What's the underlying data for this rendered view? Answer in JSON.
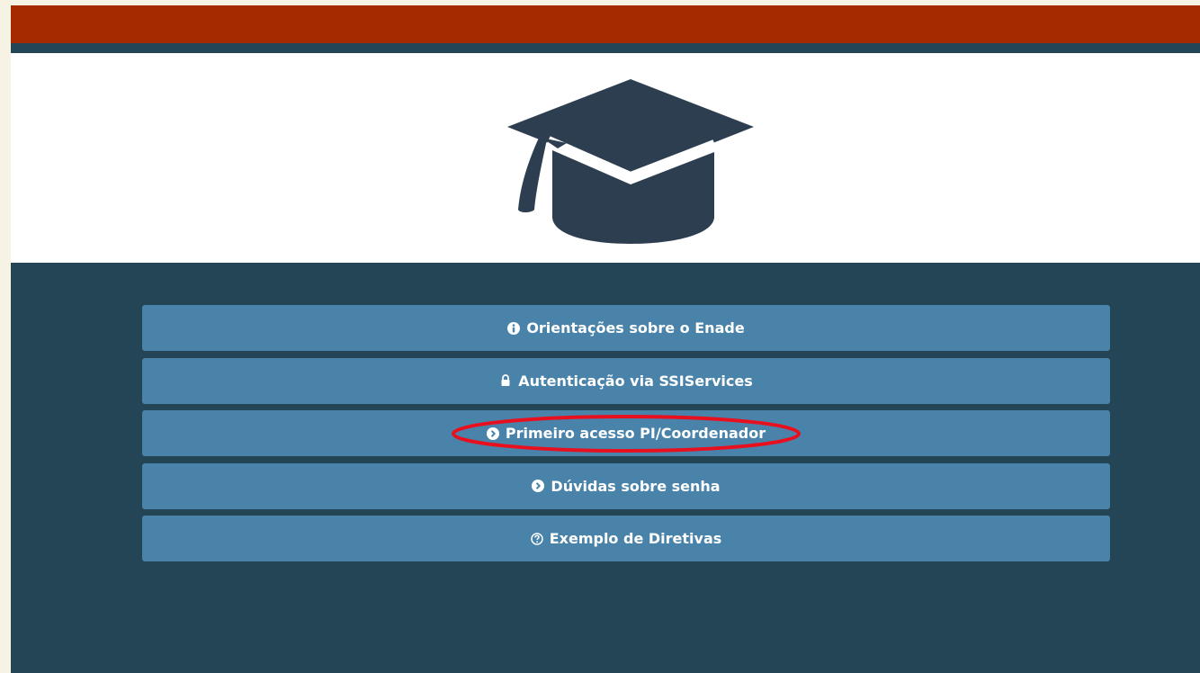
{
  "colors": {
    "page_background": "#f6f3e4",
    "top_bar": "#a52a00",
    "dark_navy": "#234556",
    "button_blue": "#4a83aa",
    "button_text": "#ffffff",
    "annotation_red": "#e8101e",
    "cap_color": "#2c3e50"
  },
  "logo": {
    "icon": "graduation-cap-icon"
  },
  "menu": {
    "items": [
      {
        "label": "Orientações sobre o Enade",
        "icon": "info-circle-icon"
      },
      {
        "label": "Autenticação via SSIServices",
        "icon": "lock-icon"
      },
      {
        "label": "Primeiro acesso PI/Coordenador",
        "icon": "arrow-circle-right-icon",
        "highlighted": true
      },
      {
        "label": "Dúvidas sobre senha",
        "icon": "arrow-circle-right-icon"
      },
      {
        "label": "Exemplo de Diretivas",
        "icon": "question-circle-icon"
      }
    ]
  }
}
